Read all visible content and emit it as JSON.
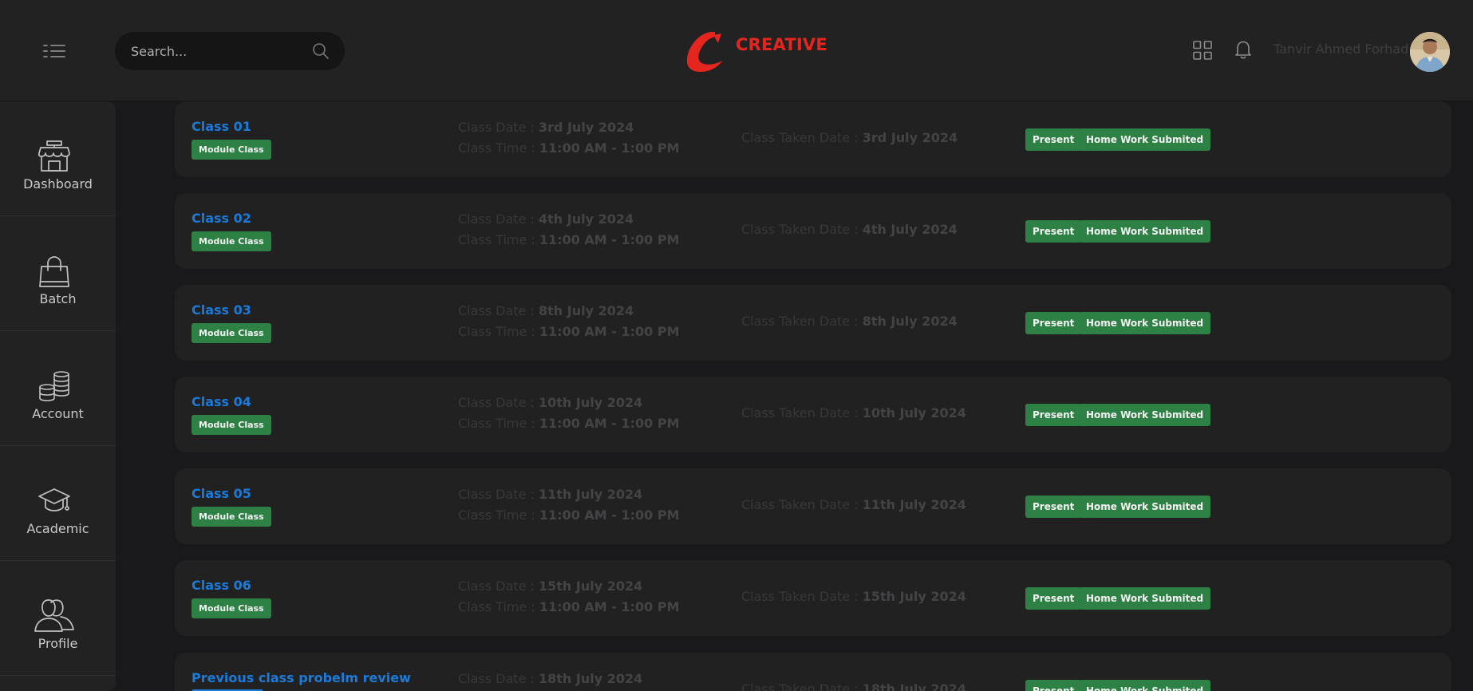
{
  "header": {
    "search_placeholder": "Search...",
    "brand_name": "CREATIVE",
    "user_name": "Tanvir Ahmed Forhad"
  },
  "sidebar": {
    "items": [
      {
        "label": "Dashboard",
        "icon": "store-icon"
      },
      {
        "label": "Batch",
        "icon": "bag-icon"
      },
      {
        "label": "Account",
        "icon": "coins-icon"
      },
      {
        "label": "Academic",
        "icon": "graduation-cap-icon"
      },
      {
        "label": "Profile",
        "icon": "users-icon"
      }
    ]
  },
  "labels": {
    "class_date": "Class Date :",
    "class_time": "Class Time :",
    "class_taken_date": "Class Taken Date :",
    "present": "Present",
    "homework": "Home Work Submited"
  },
  "classes": [
    {
      "title": "Class 01",
      "badge": "Module Class",
      "date": "3rd July 2024",
      "time": "11:00 AM - 1:00 PM",
      "taken_date": "3rd July 2024"
    },
    {
      "title": "Class 02",
      "badge": "Module Class",
      "date": "4th July 2024",
      "time": "11:00 AM - 1:00 PM",
      "taken_date": "4th July 2024"
    },
    {
      "title": "Class 03",
      "badge": "Module Class",
      "date": "8th July 2024",
      "time": "11:00 AM - 1:00 PM",
      "taken_date": "8th July 2024"
    },
    {
      "title": "Class 04",
      "badge": "Module Class",
      "date": "10th July 2024",
      "time": "11:00 AM - 1:00 PM",
      "taken_date": "10th July 2024"
    },
    {
      "title": "Class 05",
      "badge": "Module Class",
      "date": "11th July 2024",
      "time": "11:00 AM - 1:00 PM",
      "taken_date": "11th July 2024"
    },
    {
      "title": "Class 06",
      "badge": "Module Class",
      "date": "15th July 2024",
      "time": "11:00 AM - 1:00 PM",
      "taken_date": "15th July 2024"
    },
    {
      "title": "Previous class probelm review",
      "badge": "",
      "date": "18th July 2024",
      "time": "",
      "taken_date": "18th July 2024"
    }
  ],
  "colors": {
    "brand": "#e5261f",
    "link": "#1c7ad9",
    "badge_green": "#2e8144",
    "panel": "#222223",
    "background": "#19191b"
  }
}
